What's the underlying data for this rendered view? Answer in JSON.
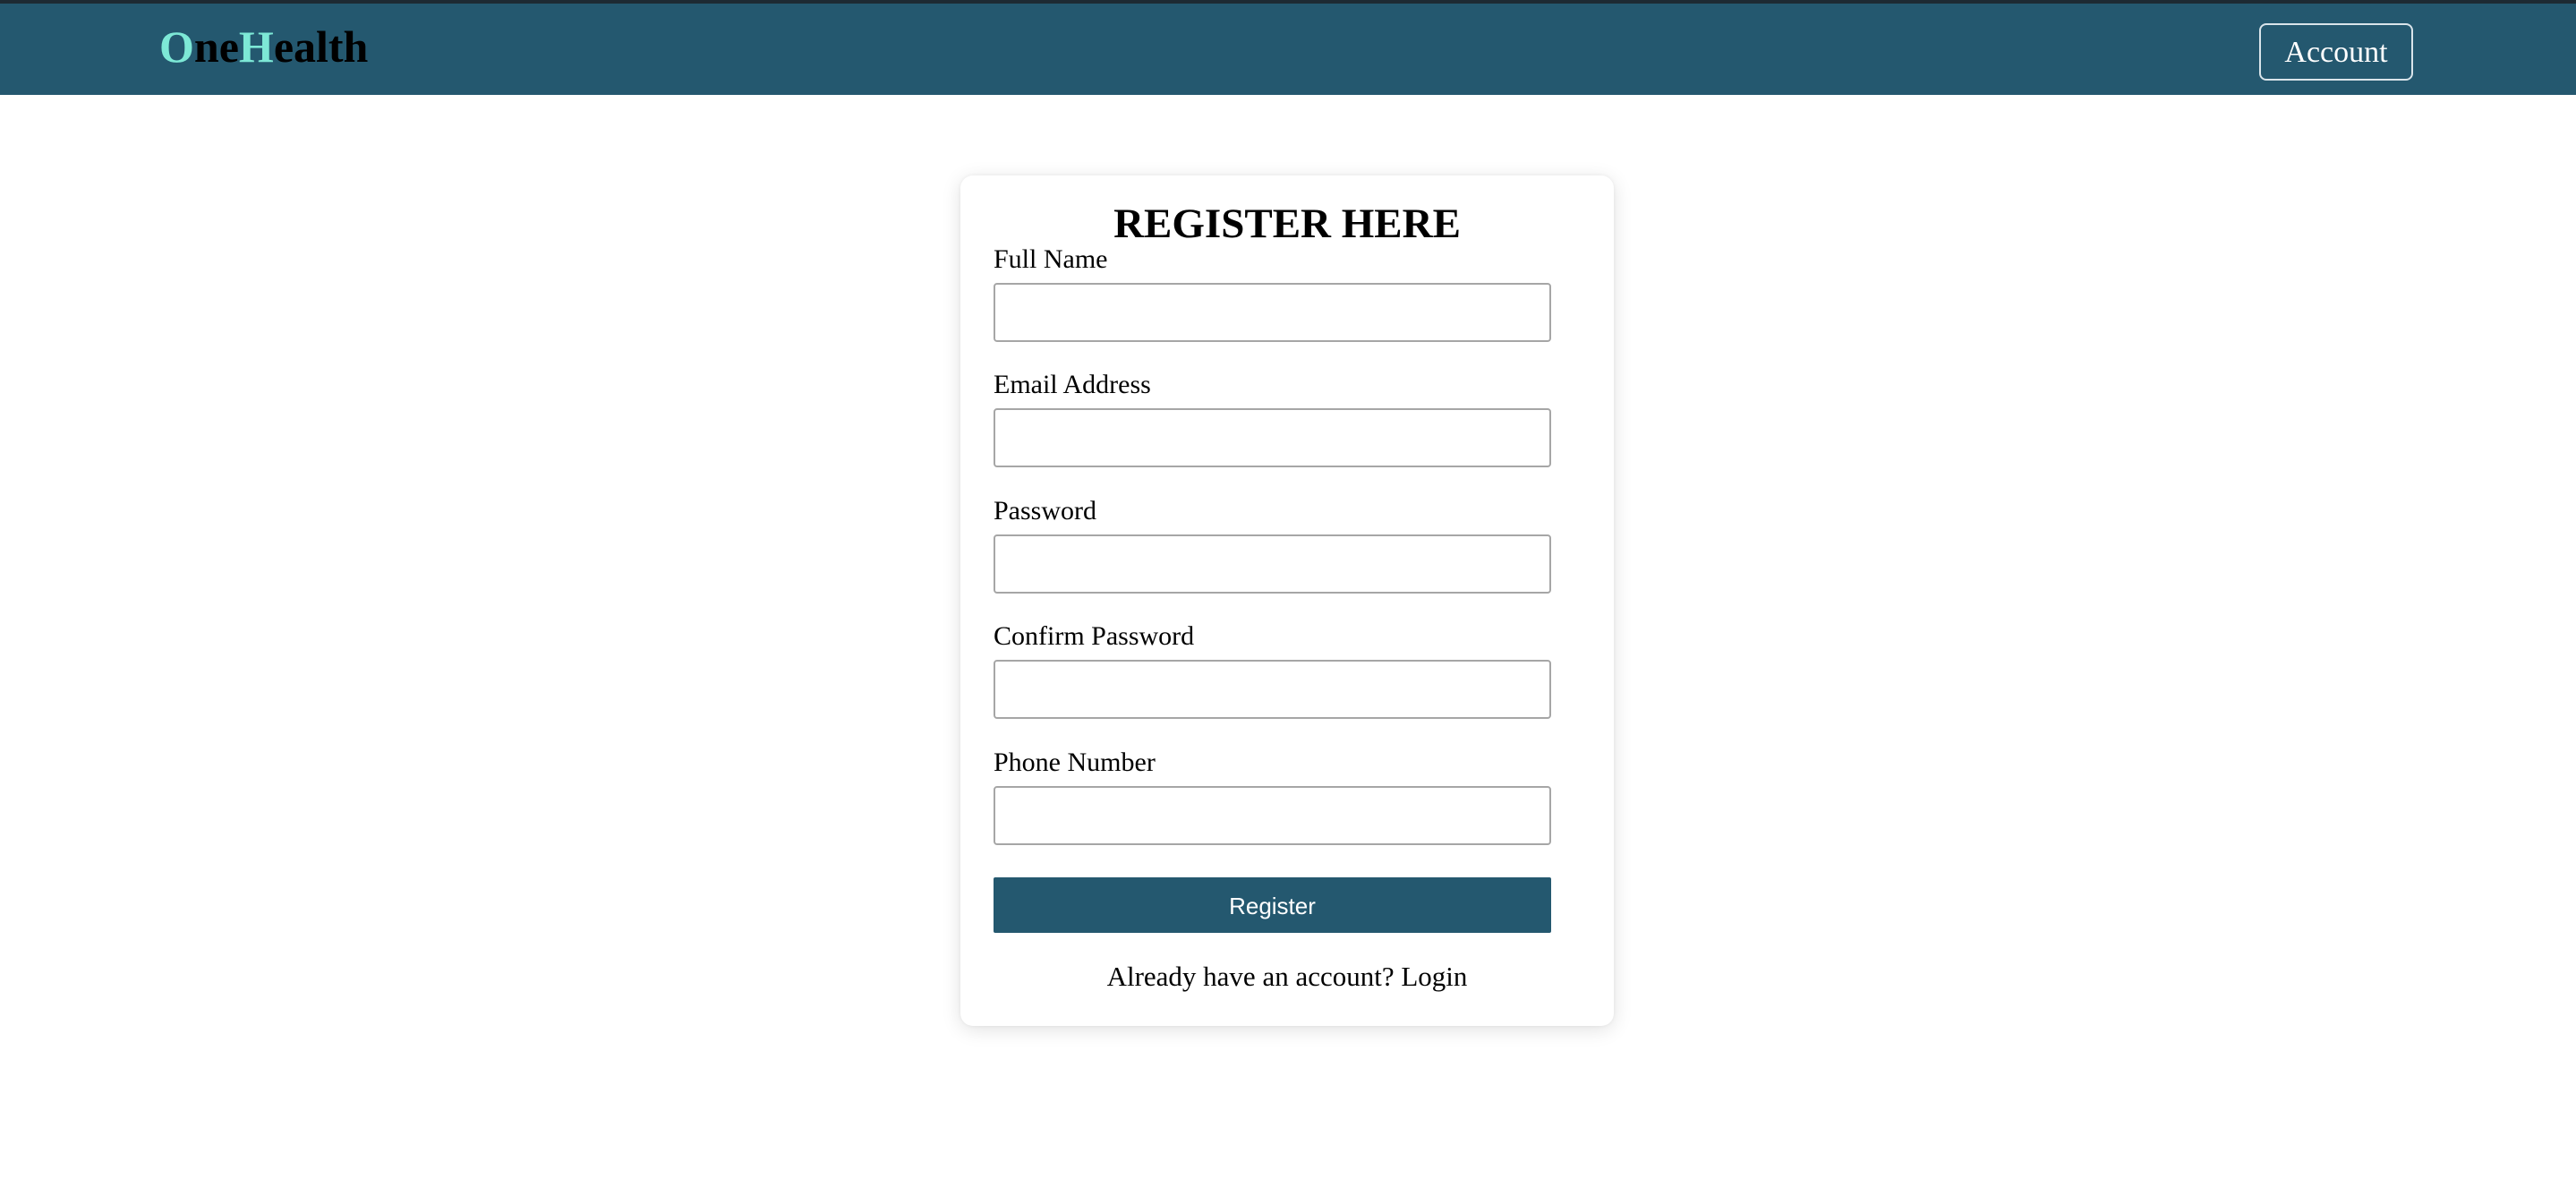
{
  "navbar": {
    "brand": {
      "parts": [
        {
          "text": "O",
          "accent": true
        },
        {
          "text": "ne",
          "accent": false
        },
        {
          "text": "H",
          "accent": true
        },
        {
          "text": "ealth",
          "accent": false
        }
      ]
    },
    "account_label": "Account"
  },
  "form": {
    "title": "REGISTER HERE",
    "fields": [
      {
        "label": "Full Name",
        "value": "",
        "type": "text"
      },
      {
        "label": "Email Address",
        "value": "",
        "type": "email"
      },
      {
        "label": "Password",
        "value": "",
        "type": "password"
      },
      {
        "label": "Confirm Password",
        "value": "",
        "type": "password"
      },
      {
        "label": "Phone Number",
        "value": "",
        "type": "tel"
      }
    ],
    "submit_label": "Register",
    "login_prompt": "Already have an account?",
    "login_link": "Login"
  },
  "colors": {
    "navbar_bg": "#24586f",
    "brand_accent": "#7de8d6",
    "button_bg": "#24586f"
  }
}
